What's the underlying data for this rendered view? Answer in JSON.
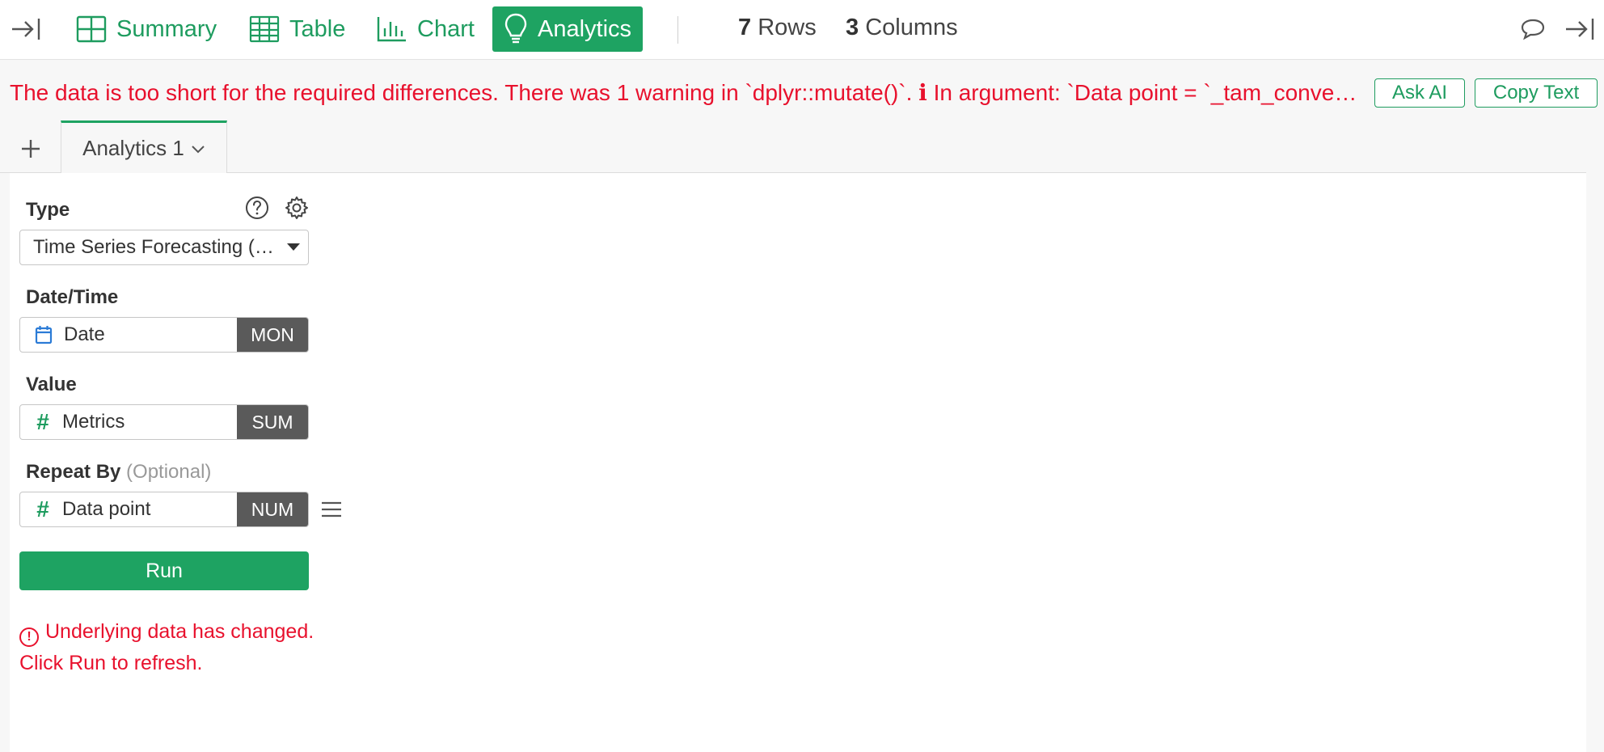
{
  "toolbar": {
    "tabs": [
      {
        "label": "Summary",
        "icon": "summary-grid-icon"
      },
      {
        "label": "Table",
        "icon": "table-icon"
      },
      {
        "label": "Chart",
        "icon": "bar-chart-icon"
      },
      {
        "label": "Analytics",
        "icon": "lightbulb-icon",
        "active": true
      }
    ],
    "rows_count": "7",
    "rows_label": "Rows",
    "columns_count": "3",
    "columns_label": "Columns"
  },
  "warning": {
    "message": "The data is too short for the required differences. There was 1 warning in `dplyr::mutate()`. ℹ In argument: `Data point = `_tam_converted_data_point_`",
    "ask_ai_label": "Ask AI",
    "copy_text_label": "Copy Text"
  },
  "analytics_tabs": {
    "add_label": "+",
    "current": "Analytics 1"
  },
  "form": {
    "type": {
      "label": "Type",
      "value": "Time Series Forecasting (Auto ARIMA)"
    },
    "date_time": {
      "label": "Date/Time",
      "column": "Date",
      "aggregation": "MON"
    },
    "value": {
      "label": "Value",
      "column": "Metrics",
      "aggregation": "SUM"
    },
    "repeat_by": {
      "label": "Repeat By",
      "optional": "(Optional)",
      "column": "Data point",
      "aggregation": "NUM"
    },
    "run_label": "Run",
    "refresh_message": "Underlying data has changed. Click Run to refresh."
  },
  "colors": {
    "brand_green": "#1ea362",
    "error_red": "#e8112d",
    "agg_gray": "#5a5a5a"
  }
}
